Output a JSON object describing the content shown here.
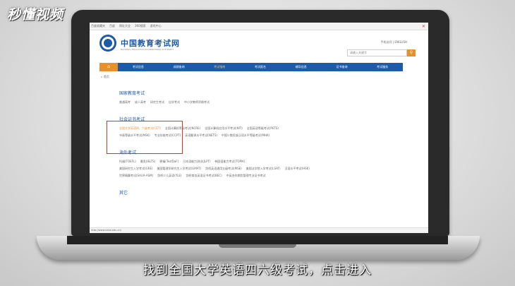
{
  "watermark": "秒懂视频",
  "subtitle": "找到全国大学英语四六级考试，点击进入",
  "browser": {
    "favorites": [
      "百度收藏夹",
      "百度",
      "网址大全",
      "360搜索",
      "游戏中心"
    ],
    "window_controls": "✕",
    "status": "http://www.neea.edu.cn/"
  },
  "site": {
    "name": "中国教育考试网",
    "subname": "NATIONAL EDUCATION EXAMINATIONS AUTHORITY",
    "top_links": "手机访问 | ENGLISH",
    "search_placeholder": "请输入关键字",
    "search_icon": "search-icon",
    "nav_home_icon": "home-icon",
    "nav": [
      "考试信息",
      "成绩查询",
      "考试指南",
      "考试报名",
      "辅导信息",
      "证书查询",
      "考试服务"
    ],
    "breadcrumb": [
      "首页"
    ]
  },
  "sections": [
    {
      "title": "国家教育考试",
      "rows": [
        [
          "普通高考",
          "成人高考",
          "研究生考试",
          "自学考试",
          "中小学教师资格考试"
        ]
      ]
    },
    {
      "title": "社会证书考试",
      "rows": [
        [
          "全国大学英语四、六级考试(CET)",
          "全国计算机等级考试(NCRE)",
          "全国计算机应用水平考试(NIT)",
          "全国英语等级考试(PETS)"
        ],
        [
          "书画等级水平考试(MSK)",
          "专业技能考试(CCPT)",
          "英语翻译水平考试(NETS)",
          "中国少数民族汉语水平等级考试(MHK)"
        ]
      ]
    },
    {
      "title": "海外考试",
      "rows": [
        [
          "托福(TOEFL)",
          "雅思(IELTS)",
          "德福(TestDaF)",
          "日本语能力测试(JLPT)",
          "韩国语能力考试(TOPIK)"
        ],
        [
          "美国研究生入学考试(GRE)",
          "美国管理学研究生入学考试(GMAT)",
          "剑桥英语通用五级考试(MSE)",
          "美国法学院入学考试(LSAT)",
          "汉语水平考试(HSK)"
        ],
        [
          "世界精算考试(SAUA-ASM)",
          "剑桥少儿英语(YLE)",
          "剑桥商务英语证书考试(BEC)",
          "中英合作期货管理专业证书考试"
        ]
      ]
    },
    {
      "title": "其它",
      "rows": []
    }
  ]
}
